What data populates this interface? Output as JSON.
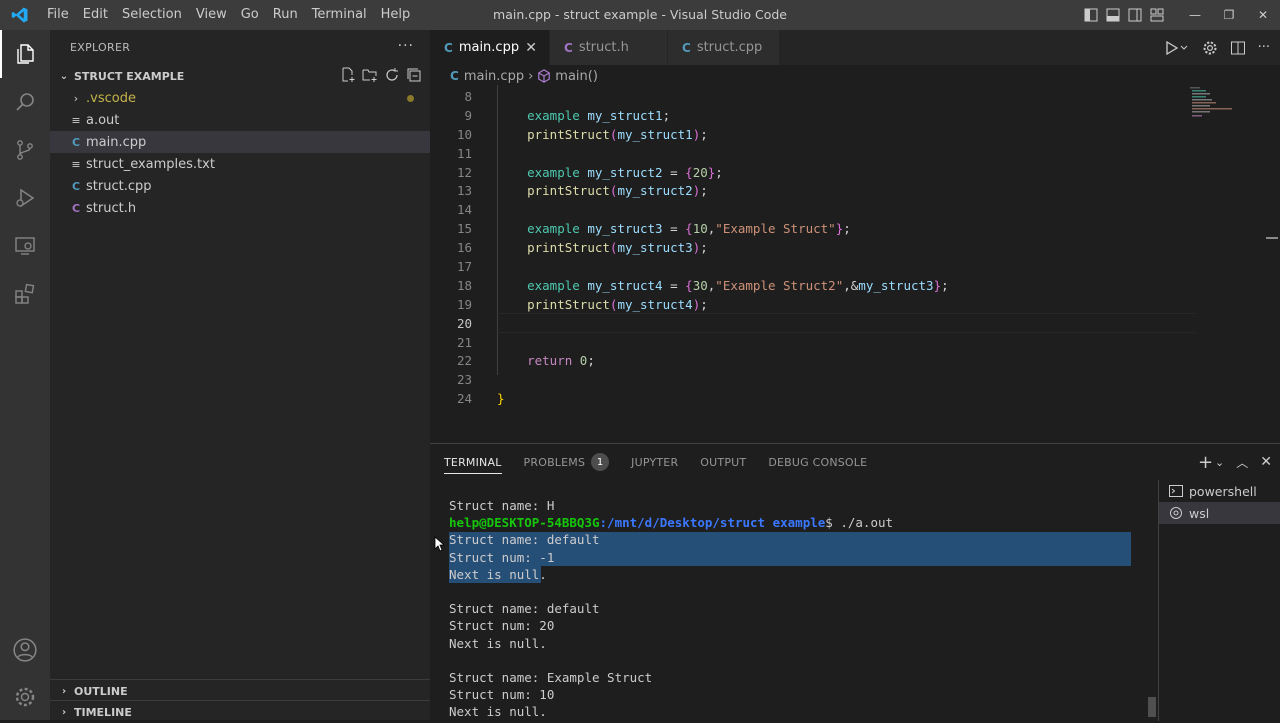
{
  "window": {
    "title": "main.cpp - struct example - Visual Studio Code",
    "menu": [
      "File",
      "Edit",
      "Selection",
      "View",
      "Go",
      "Run",
      "Terminal",
      "Help"
    ]
  },
  "sidebar": {
    "header": "EXPLORER",
    "folder": "STRUCT EXAMPLE",
    "items": [
      {
        "label": ".vscode",
        "icon": "chevron-right-icon"
      },
      {
        "label": "a.out",
        "icon": "file-lines-icon"
      },
      {
        "label": "main.cpp",
        "icon": "cpp-file-icon"
      },
      {
        "label": "struct_examples.txt",
        "icon": "file-lines-icon"
      },
      {
        "label": "struct.cpp",
        "icon": "cpp-file-icon"
      },
      {
        "label": "struct.h",
        "icon": "h-file-icon"
      }
    ],
    "outline": "OUTLINE",
    "timeline": "TIMELINE"
  },
  "editor": {
    "tabs": [
      {
        "label": "main.cpp",
        "icon": "C",
        "active": true
      },
      {
        "label": "struct.h",
        "icon": "C",
        "active": false
      },
      {
        "label": "struct.cpp",
        "icon": "C",
        "active": false
      }
    ],
    "breadcrumb": {
      "file": "main.cpp",
      "symbol": "main()"
    },
    "line_numbers": [
      "8",
      "9",
      "10",
      "11",
      "12",
      "13",
      "14",
      "15",
      "16",
      "17",
      "18",
      "19",
      "20",
      "21",
      "22",
      "23",
      "24"
    ],
    "current_line": "20"
  },
  "panel": {
    "tabs": [
      "TERMINAL",
      "PROBLEMS",
      "JUPYTER",
      "OUTPUT",
      "DEBUG CONSOLE"
    ],
    "problems_count": "1",
    "prompt_user": "help@DESKTOP-54BBQ3G",
    "prompt_path": ":/mnt/d/Desktop/struct example",
    "prompt_cmd": "$ ./a.out",
    "output": [
      "Struct name: H",
      "Struct name: default",
      "Struct num: -1",
      "Next is null.",
      "",
      "Struct name: default",
      "Struct num: 20",
      "Next is null.",
      "",
      "Struct name: Example Struct",
      "Struct num: 10",
      "Next is null."
    ],
    "terminals": [
      "powershell",
      "wsl"
    ]
  },
  "colors": {
    "accent": "#007acc",
    "selection": "#264f78"
  }
}
